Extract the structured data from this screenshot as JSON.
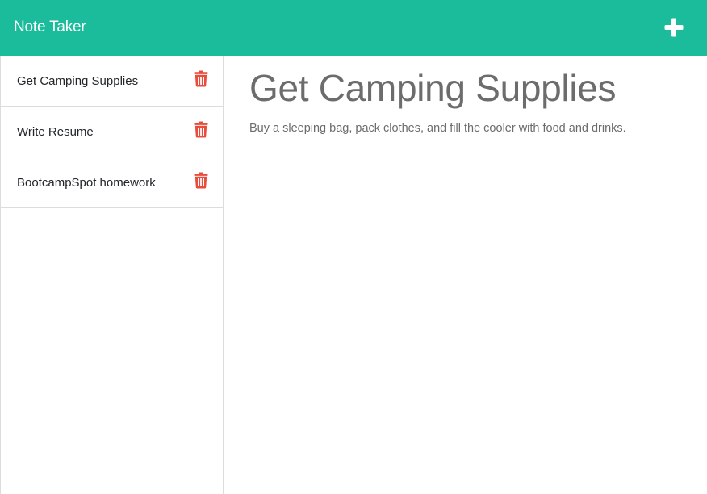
{
  "header": {
    "title": "Note Taker",
    "add_icon": "plus-icon",
    "background_color": "#1abc9c"
  },
  "sidebar": {
    "items": [
      {
        "label": "Get Camping Supplies",
        "icon": "trash-icon"
      },
      {
        "label": "Write Resume",
        "icon": "trash-icon"
      },
      {
        "label": "BootcampSpot homework",
        "icon": "trash-icon"
      }
    ],
    "delete_icon_color": "#e74c3c"
  },
  "main": {
    "note_title": "Get Camping Supplies",
    "note_text": "Buy a sleeping bag, pack clothes, and fill the cooler with food and drinks."
  }
}
